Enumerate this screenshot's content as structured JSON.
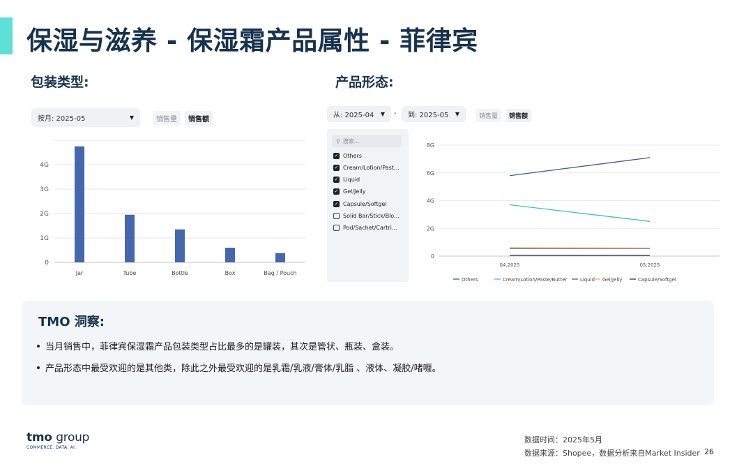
{
  "header": {
    "title": "保湿与滋养 - 保湿霜产品属性 - 菲律宾"
  },
  "left_section": {
    "label": "包装类型:",
    "period_select": "按月: 2025-05",
    "toggle": {
      "off": "销售量",
      "on": "销售额"
    }
  },
  "right_section": {
    "label": "产品形态:",
    "from_select": "从: 2025-04",
    "to_select": "到: 2025-05",
    "range_sep": "-",
    "toggle": {
      "off": "销售量",
      "on": "销售额"
    },
    "filter": {
      "search_placeholder": "搜索...",
      "items": [
        {
          "label": "Others",
          "checked": true
        },
        {
          "label": "Cream/Lotion/Past...",
          "checked": true
        },
        {
          "label": "Liquid",
          "checked": true
        },
        {
          "label": "Gel/Jelly",
          "checked": true
        },
        {
          "label": "Capsule/Softgel",
          "checked": true
        },
        {
          "label": "Solid Bar/Stick/Blo...",
          "checked": false
        },
        {
          "label": "Pod/Sachet/Cartri...",
          "checked": false
        }
      ]
    }
  },
  "chart_data": [
    {
      "type": "bar",
      "categories": [
        "Jar",
        "Tube",
        "Bottle",
        "Box",
        "Bag / Pouch"
      ],
      "values": [
        4.75,
        1.95,
        1.35,
        0.6,
        0.38
      ],
      "yticks": [
        "0",
        "1G",
        "2G",
        "3G",
        "4G"
      ],
      "ylim": [
        0,
        5
      ],
      "color": "#4467ad",
      "grid": true
    },
    {
      "type": "line",
      "x": [
        "04.2025",
        "05.2025"
      ],
      "yticks": [
        "0",
        "2G",
        "4G",
        "6G",
        "8G"
      ],
      "ylim": [
        0,
        8
      ],
      "grid": true,
      "legend_position": "bottom",
      "series": [
        {
          "name": "Others",
          "values": [
            5.8,
            7.1
          ],
          "color": "#3d5a8a"
        },
        {
          "name": "Cream/Lotion/Paste/Butter",
          "values": [
            3.7,
            2.5
          ],
          "color": "#3cc2b3"
        },
        {
          "name": "Liquid",
          "values": [
            0.55,
            0.55
          ],
          "color": "#4b55b5"
        },
        {
          "name": "Gel/Jelly",
          "values": [
            0.6,
            0.58
          ],
          "color": "#f2b24a"
        },
        {
          "name": "Capsule/Softgel",
          "values": [
            0.05,
            0.05
          ],
          "color": "#2e3440"
        }
      ]
    }
  ],
  "insight": {
    "title": "TMO 洞察:",
    "items": [
      "当月销售中，菲律宾保湿霜产品包装类型占比最多的是罐装，其次是管状、瓶装、盒装。",
      "产品形态中最受欢迎的是其他类，除此之外最受欢迎的是乳霜/乳液/膏体/乳脂 、液体、凝胶/啫喱。"
    ]
  },
  "footer": {
    "logo_main": "tmo",
    "logo_group": "group",
    "logo_sub": "COMMERCE. DATA. AI.",
    "data_time": "数据时间：2025年5月",
    "data_source": "数据来源：Shopee，数据分析来自Market Insider",
    "page_number": "26"
  }
}
